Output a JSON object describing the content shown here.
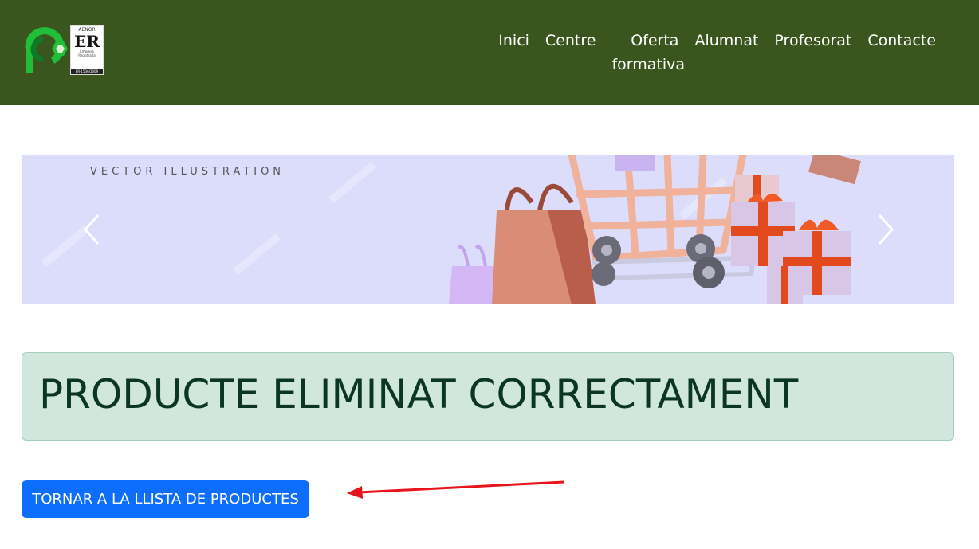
{
  "header": {
    "logo_icon": "school-logo-icon",
    "certification": {
      "top_text": "AENOR",
      "mark": "ER",
      "subtitle_line1": "Empresa",
      "subtitle_line2": "Registrada",
      "code": "ER-1536/2009"
    },
    "nav": [
      {
        "label": "Inici"
      },
      {
        "label": "Centre"
      },
      {
        "label": "Oferta formativa"
      },
      {
        "label": "Alumnat"
      },
      {
        "label": "Profesorat"
      },
      {
        "label": "Contacte"
      }
    ],
    "background_color": "#3a551e"
  },
  "banner": {
    "caption": "VECTOR ILLUSTRATION",
    "prev_icon": "chevron-left-icon",
    "next_icon": "chevron-right-icon"
  },
  "alert": {
    "message": "PRODUCTE ELIMINAT CORRECTAMENT",
    "background_color": "#d1e7dd",
    "text_color": "#0a3622"
  },
  "back_button": {
    "label": "TORNAR A LA LLISTA DE PRODUCTES",
    "color": "#0d6efd"
  },
  "annotation": {
    "icon": "red-arrow-icon",
    "color": "#e8141b"
  }
}
